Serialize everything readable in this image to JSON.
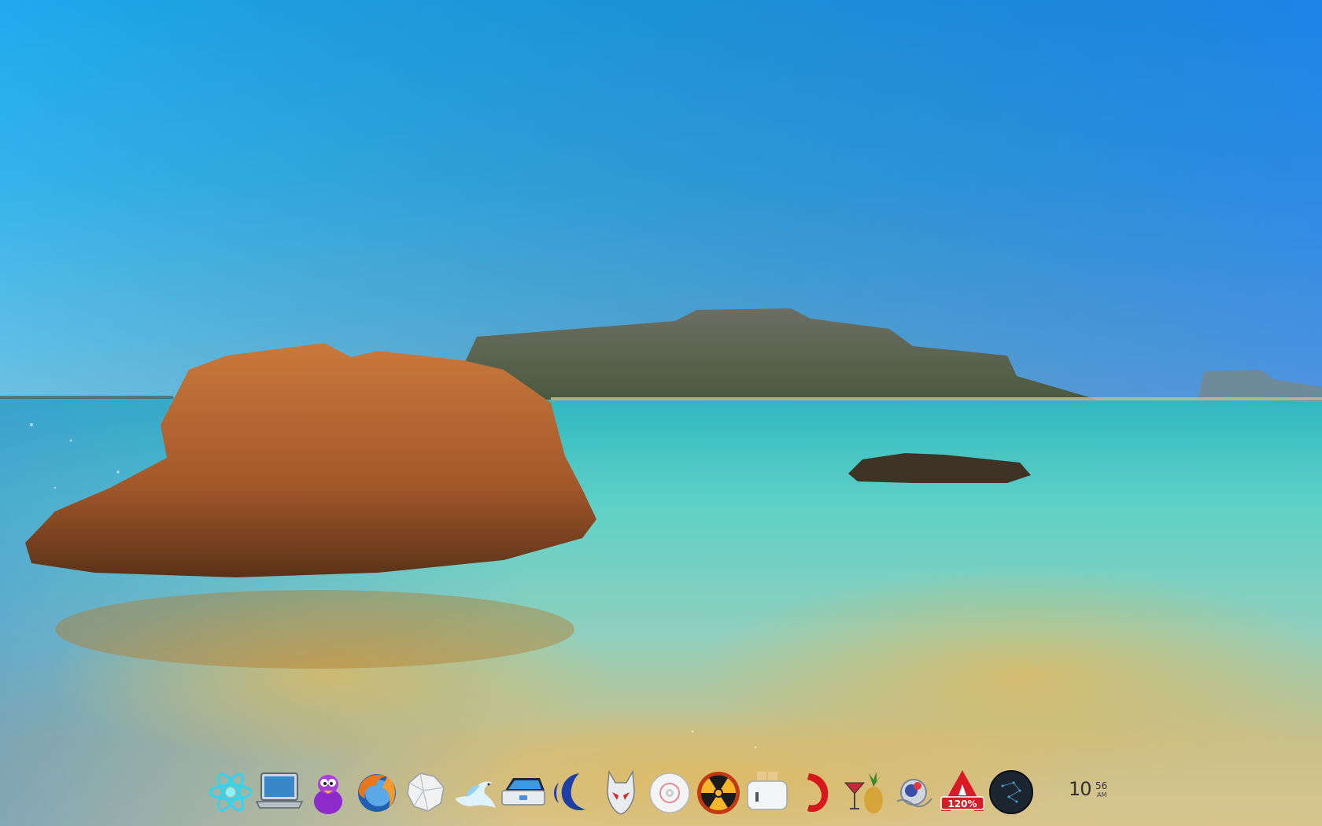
{
  "desktop": {
    "wallpaper": "beach-lagoon-rock-landscape"
  },
  "dock": {
    "items": [
      {
        "name": "atom-app",
        "icon": "atom-icon"
      },
      {
        "name": "laptop-finder",
        "icon": "laptop-icon"
      },
      {
        "name": "purple-creature",
        "icon": "purple-monster-icon"
      },
      {
        "name": "firefox-browser",
        "icon": "firefox-icon"
      },
      {
        "name": "crumpled-paper",
        "icon": "crumpled-paper-icon"
      },
      {
        "name": "dove-messenger",
        "icon": "dove-icon"
      },
      {
        "name": "scanner",
        "icon": "scanner-icon"
      },
      {
        "name": "moon-crescent-app",
        "icon": "crescent-moon-icon"
      },
      {
        "name": "alien-head",
        "icon": "alien-icon"
      },
      {
        "name": "disc-burner",
        "icon": "disc-icon"
      },
      {
        "name": "radiation-app",
        "icon": "radiation-icon"
      },
      {
        "name": "toaster-app",
        "icon": "toaster-icon"
      },
      {
        "name": "red-hook",
        "icon": "red-hook-icon"
      },
      {
        "name": "cocktail-pineapple",
        "icon": "cocktail-pineapple-icon"
      },
      {
        "name": "orb-dock",
        "icon": "orb-icon"
      },
      {
        "name": "acrobat-zoom",
        "icon": "acrobat-icon",
        "badge": "120%"
      },
      {
        "name": "dark-sphere",
        "icon": "dark-sphere-icon"
      }
    ]
  },
  "clock": {
    "hours": "10",
    "minutes": "56",
    "ampm": "AM"
  }
}
